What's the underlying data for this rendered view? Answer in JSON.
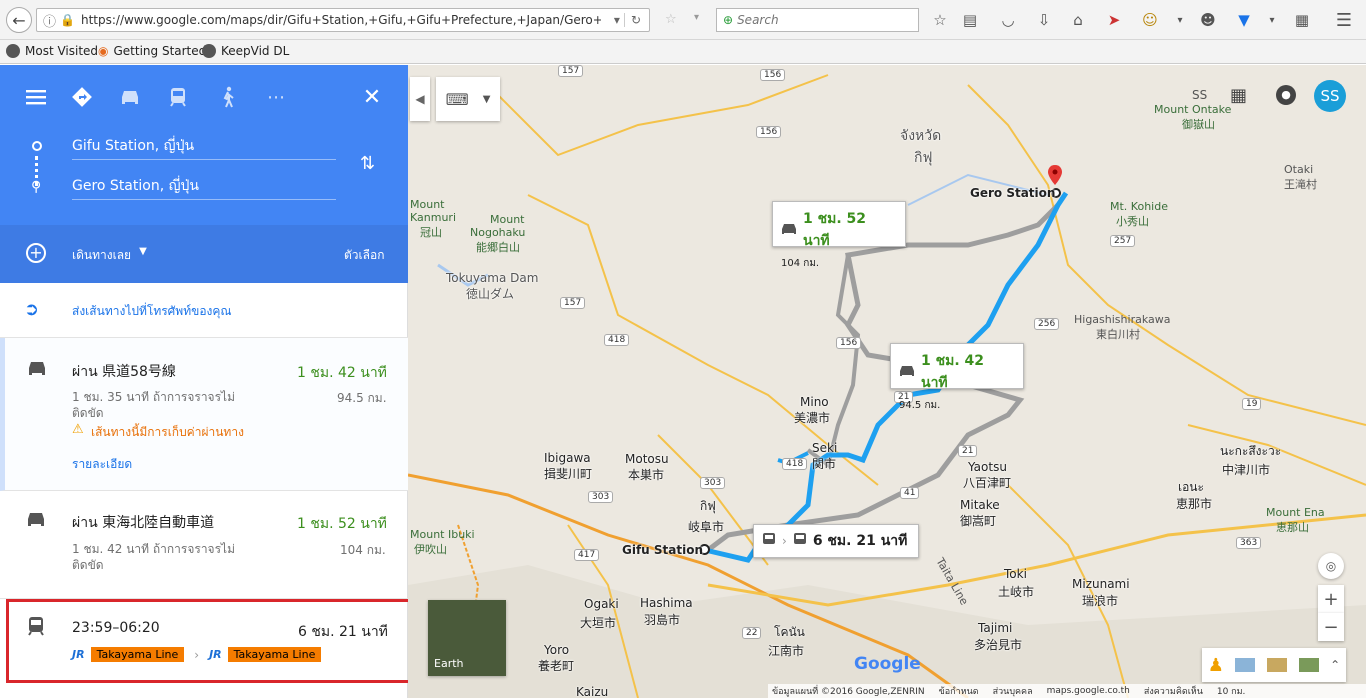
{
  "browser": {
    "url": "https://www.google.com/maps/dir/Gifu+Station,+Gifu,+Gifu+Prefecture,+Japan/Gero+Station,",
    "url_host": "www.google.com",
    "search_placeholder": "Search",
    "bookmarks": [
      "Most Visited",
      "Getting Started",
      "KeepVid DL"
    ]
  },
  "sidebar": {
    "origin": "Gifu Station, ญี่ปุ่น",
    "destination": "Gero Station, ญี่ปุ่น",
    "depart_label": "เดินทางเลย",
    "options_label": "ตัวเลือก",
    "send_label": "ส่งเส้นทางไปที่โทรศัพท์ของคุณ",
    "routes": [
      {
        "via": "ผ่าน 県道58号線",
        "time": "1 ชม. 42 นาที",
        "note": "1 ชม. 35 นาที ถ้าการจราจรไม่ติดขัด",
        "dist": "94.5 กม.",
        "warning": "เส้นทางนี้มีการเก็บค่าผ่านทาง",
        "details": "รายละเอียด"
      },
      {
        "via": "ผ่าน 東海北陸自動車道",
        "time": "1 ชม. 52 นาที",
        "note": "1 ชม. 42 นาที ถ้าการจราจรไม่ติดขัด",
        "dist": "104 กม."
      }
    ],
    "transit": {
      "times": "23:59–06:20",
      "duration": "6 ชม. 21 นาที",
      "line1": "Takayama Line",
      "line2": "Takayama Line",
      "jr": "JR"
    }
  },
  "map": {
    "account_initials": "SS",
    "user_label": "SS",
    "earth_label": "Earth",
    "callouts": {
      "car1_time": "1 ชม. 52 นาที",
      "car1_dist": "104 กม.",
      "car2_time": "1 ชม. 42 นาที",
      "car2_dist": "94.5 กม.",
      "transit_time": "6 ชม. 21 นาที"
    },
    "places": {
      "gifu": "Gifu Station",
      "gero": "Gero Station",
      "pref1": "จังหวัด",
      "pref2": "กิฟุ",
      "mino": "Mino",
      "mino_jp": "美濃市",
      "seki": "Seki",
      "seki_jp": "関市",
      "motosu": "Motosu",
      "motosu_jp": "本巣市",
      "gifu_th": "กิฟุ",
      "gifu_jp": "岐阜市",
      "ibigawa": "Ibigawa",
      "ibigawa_jp": "揖斐川町",
      "tokuyama": "Tokuyama Dam",
      "tokuyama_jp": "徳山ダム",
      "mt_nogoh": "Mount",
      "mt_nogoh2": "Nogohaku",
      "mt_nogoh_jp": "能郷白山",
      "kanmuri": "Mount",
      "kanmuri2": "Kanmuri",
      "kanmuri_jp": "冠山",
      "ontake": "Mount Ontake",
      "ontake_jp": "御嶽山",
      "kohide": "Mt. Kohide",
      "kohide_jp": "小秀山",
      "otaki": "Otaki",
      "otaki_jp": "王滝村",
      "higashi": "Higashishirakawa",
      "higashi_jp": "東白川村",
      "yaotsu": "Yaotsu",
      "yaotsu_jp": "八百津町",
      "mitake": "Mitake",
      "mitake_jp": "御嵩町",
      "nakatsugawa": "นะกะสึงะวะ",
      "nakatsugawa_jp": "中津川市",
      "ena": "เอนะ",
      "ena_jp": "恵那市",
      "mount_ena": "Mount Ena",
      "mount_ena_jp": "恵那山",
      "toki": "Toki",
      "toki_jp": "土岐市",
      "mizunami": "Mizunami",
      "mizunami_jp": "瑞浪市",
      "tajimi": "Tajimi",
      "tajimi_jp": "多治見市",
      "ogaki": "Ogaki",
      "ogaki_jp": "大垣市",
      "hashima": "Hashima",
      "hashima_jp": "羽島市",
      "konan": "โคนัน",
      "konan_jp": "江南市",
      "yoro": "Yoro",
      "yoro_jp": "養老町",
      "ibuki": "Mount Ibuki",
      "ibuki_jp": "伊吹山",
      "kaizu": "Kaizu",
      "tajima_line": "Taita Line"
    },
    "shields": [
      "157",
      "156",
      "157",
      "417",
      "418",
      "418",
      "156",
      "303",
      "303",
      "21",
      "21",
      "41",
      "41",
      "256",
      "256",
      "257",
      "19",
      "19",
      "363",
      "417",
      "22",
      "21"
    ],
    "google_logo": "Google",
    "footer": [
      "ข้อมูลแผนที่ ©2016 Google,ZENRIN",
      "ข้อกำหนด",
      "ส่วนบุคคล",
      "maps.google.co.th",
      "ส่งความคิดเห็น",
      "10 กม."
    ]
  }
}
